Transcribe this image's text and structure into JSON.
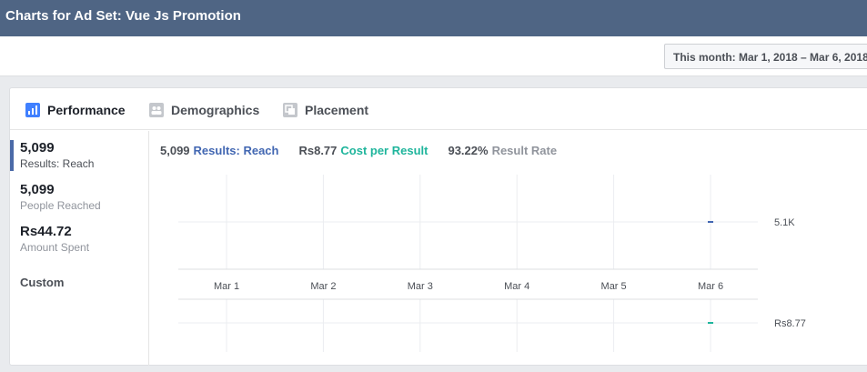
{
  "header": {
    "title": "Charts for Ad Set: Vue Js Promotion"
  },
  "date_range": {
    "label": "This month: Mar 1, 2018 – Mar 6, 2018"
  },
  "tabs": [
    {
      "label": "Performance",
      "icon": "bar-chart-icon"
    },
    {
      "label": "Demographics",
      "icon": "people-icon"
    },
    {
      "label": "Placement",
      "icon": "placement-icon"
    }
  ],
  "sidebar": {
    "metrics": [
      {
        "value": "5,099",
        "label": "Results: Reach"
      },
      {
        "value": "5,099",
        "label": "People Reached"
      },
      {
        "value": "Rs44.72",
        "label": "Amount Spent"
      }
    ],
    "custom_label": "Custom"
  },
  "summary": {
    "results_value": "5,099",
    "results_label": "Results: Reach",
    "cost_value": "Rs8.77",
    "cost_label": "Cost per Result",
    "rate_value": "93.22%",
    "rate_label": "Result Rate"
  },
  "colors": {
    "results": "#4267b2",
    "cost": "#1fb59c",
    "header": "#4f6584"
  },
  "chart_data": [
    {
      "type": "line",
      "x": [
        "Mar 1",
        "Mar 2",
        "Mar 3",
        "Mar 4",
        "Mar 5",
        "Mar 6"
      ],
      "series": [
        {
          "name": "Results: Reach",
          "values": [
            null,
            null,
            null,
            null,
            null,
            5099
          ]
        }
      ],
      "y_tick_label": "5.1K",
      "grid": true
    },
    {
      "type": "line",
      "x": [
        "Mar 1",
        "Mar 2",
        "Mar 3",
        "Mar 4",
        "Mar 5",
        "Mar 6"
      ],
      "series": [
        {
          "name": "Cost per Result",
          "values": [
            null,
            null,
            null,
            null,
            null,
            8.77
          ]
        }
      ],
      "y_tick_label": "Rs8.77",
      "grid": true
    }
  ]
}
